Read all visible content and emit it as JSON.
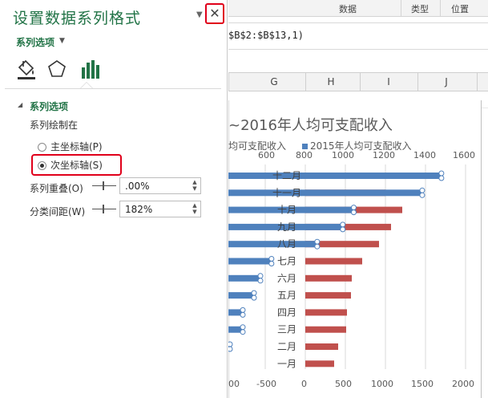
{
  "excel": {
    "ribbon_groups": [
      "数据",
      "类型",
      "位置"
    ],
    "formula": "$B$2:$B$13,1)",
    "columns": [
      "G",
      "H",
      "I",
      "J"
    ]
  },
  "chart": {
    "title": "~2016年人均可支配收入",
    "legend": [
      "均可支配收入",
      "2015年人均可支配收入"
    ],
    "top_axis_ticks": [
      "600",
      "800",
      "1000",
      "1200",
      "1400",
      "1600"
    ],
    "bottom_axis_ticks": [
      "00",
      "-500",
      "0",
      "500",
      "1000",
      "1500",
      "2000"
    ]
  },
  "chart_data": {
    "type": "bar",
    "title": "~2016年人均可支配收入",
    "categories": [
      "一月",
      "二月",
      "三月",
      "四月",
      "五月",
      "六月",
      "七月",
      "八月",
      "九月",
      "十月",
      "十一月",
      "十二月"
    ],
    "series": [
      {
        "name": "2015年人均可支配收入",
        "axis": "secondary",
        "values": [
          null,
          null,
          null,
          null,
          null,
          null,
          630,
          880,
          1020,
          1080,
          1455,
          1560
        ]
      },
      {
        "name": "",
        "axis": "primary",
        "values": [
          360,
          410,
          510,
          520,
          570,
          580,
          710,
          920,
          1070,
          1210,
          1000,
          1000
        ]
      }
    ],
    "secondary_axis_range": [
      600,
      1600
    ],
    "primary_axis_range": [
      -1000,
      2000
    ],
    "grid": true,
    "legend_position": "top"
  },
  "pane": {
    "title": "设置数据系列格式",
    "subtitle": "系列选项",
    "section": "系列选项",
    "plot_on_label": "系列绘制在",
    "radio_primary": "主坐标轴(P)",
    "radio_secondary": "次坐标轴(S)",
    "selected_axis": "secondary",
    "overlap_label": "系列重叠(O)",
    "overlap_value": ".00%",
    "gap_label": "分类间距(W)",
    "gap_value": "182%",
    "close_symbol": "✕"
  },
  "colors": {
    "accent": "#217346",
    "series_blue": "#4f81bd",
    "series_red": "#c0504d",
    "highlight": "#e0001a"
  }
}
